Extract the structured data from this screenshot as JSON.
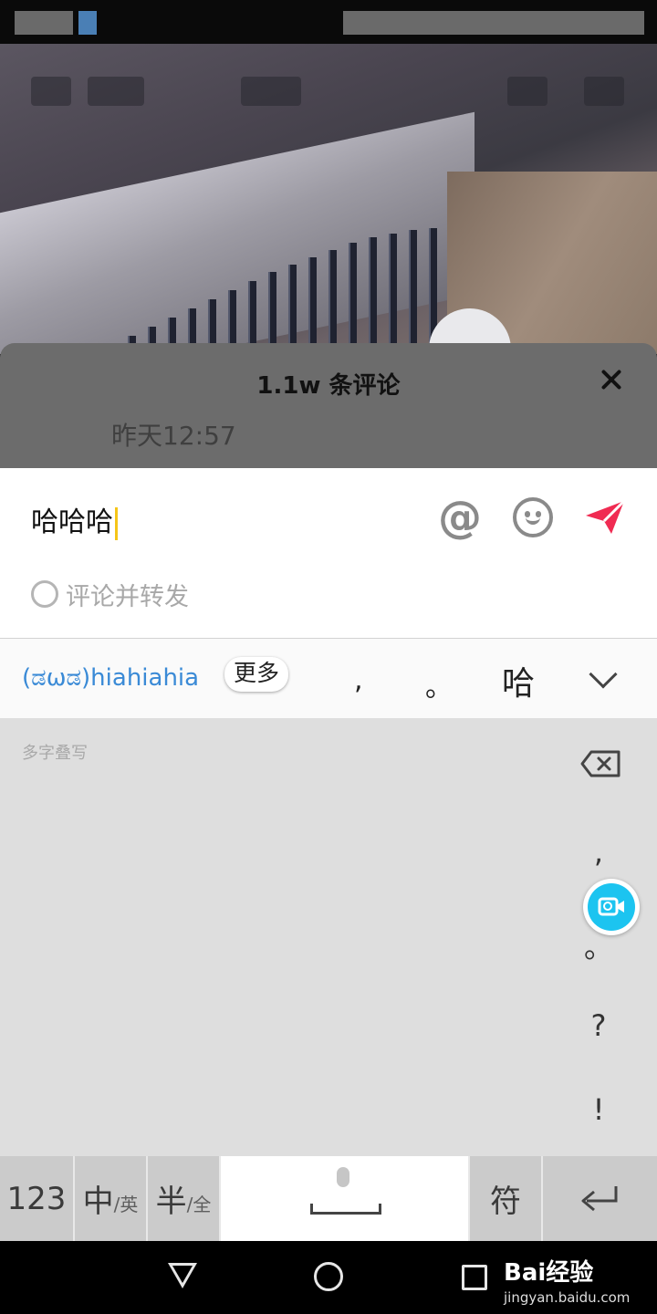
{
  "comment_sheet": {
    "title": "1.1w 条评论",
    "timestamp": "昨天12:57"
  },
  "input_panel": {
    "text": "哈哈哈",
    "at_symbol": "@",
    "repost_label": "评论并转发",
    "accent_color": "#f02b52"
  },
  "candidate_bar": {
    "emoticon": "(ಡωಡ)hiahiahia",
    "more_label": "更多",
    "candidates": [
      ",",
      "。",
      "哈"
    ]
  },
  "handwriting": {
    "hint": "多字叠写",
    "punctuation": [
      ",",
      "。",
      "?",
      "!"
    ],
    "camera_color": "#1cc4f0"
  },
  "keyboard": {
    "numbers_key": "123",
    "lang_key_main": "中",
    "lang_key_sub": "/英",
    "width_key_main": "半",
    "width_key_sub": "/全",
    "symbols_key": "符"
  },
  "watermark": {
    "brand": "Bai经验",
    "url": "jingyan.baidu.com"
  }
}
